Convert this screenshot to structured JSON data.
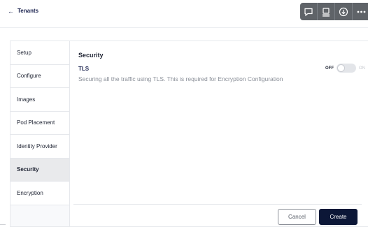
{
  "header": {
    "back_arrow": "←",
    "back_label": "Tenants",
    "toolbar": [
      {
        "icon": "comment-icon"
      },
      {
        "icon": "document-icon"
      },
      {
        "icon": "download-icon"
      },
      {
        "icon": "more-icon"
      }
    ]
  },
  "sidebar": {
    "items": [
      {
        "label": "Setup",
        "active": false
      },
      {
        "label": "Configure",
        "active": false
      },
      {
        "label": "Images",
        "active": false
      },
      {
        "label": "Pod Placement",
        "active": false
      },
      {
        "label": "Identity Provider",
        "active": false
      },
      {
        "label": "Security",
        "active": true
      },
      {
        "label": "Encryption",
        "active": false
      }
    ]
  },
  "main": {
    "section_title": "Security",
    "tls": {
      "label": "TLS",
      "description": "Securing all the traffic using TLS. This is required for Encryption Configuration",
      "toggle_off_label": "OFF",
      "toggle_on_label": "ON",
      "enabled": false
    }
  },
  "footer": {
    "cancel_label": "Cancel",
    "create_label": "Create"
  },
  "colors": {
    "primary": "#0c1737",
    "link": "#1c2450",
    "toolbar_bg": "#5f6368",
    "active_item_bg": "#e9eaec"
  }
}
